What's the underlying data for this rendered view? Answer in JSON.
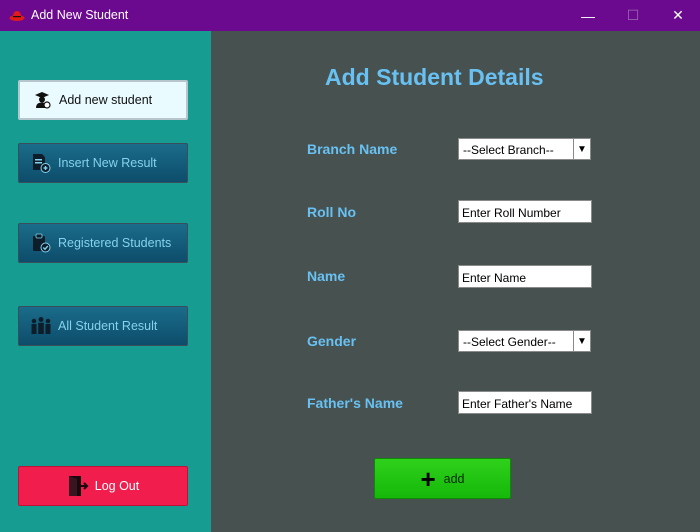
{
  "window": {
    "title": "Add New Student",
    "minimize": "—",
    "maximize": "☐",
    "close": "✕"
  },
  "sidebar": {
    "items": [
      {
        "label": "Add new student",
        "icon": "student-icon",
        "active": true
      },
      {
        "label": "Insert New Result",
        "icon": "add-document-icon"
      },
      {
        "label": "Registered Students",
        "icon": "clipboard-check-icon"
      },
      {
        "label": "All Student Result",
        "icon": "group-icon"
      }
    ],
    "logout": {
      "label": "Log Out",
      "icon": "exit-door-icon"
    }
  },
  "main": {
    "title": "Add Student Details",
    "fields": {
      "branch": {
        "label": "Branch Name",
        "value": "--Select Branch--"
      },
      "roll": {
        "label": "Roll No",
        "value": "Enter Roll Number"
      },
      "name": {
        "label": "Name",
        "value": "Enter Name"
      },
      "gender": {
        "label": "Gender",
        "value": "--Select Gender--"
      },
      "father": {
        "label": "Father's Name",
        "value": "Enter Father's Name"
      }
    },
    "add_button": {
      "label": "add",
      "icon": "plus-icon"
    }
  },
  "colors": {
    "titlebar": "#6c0a8f",
    "sidebar": "#169c90",
    "main_bg": "#475250",
    "accent_text": "#68c1f2",
    "logout": "#f01d4d",
    "add": "#22c511"
  }
}
